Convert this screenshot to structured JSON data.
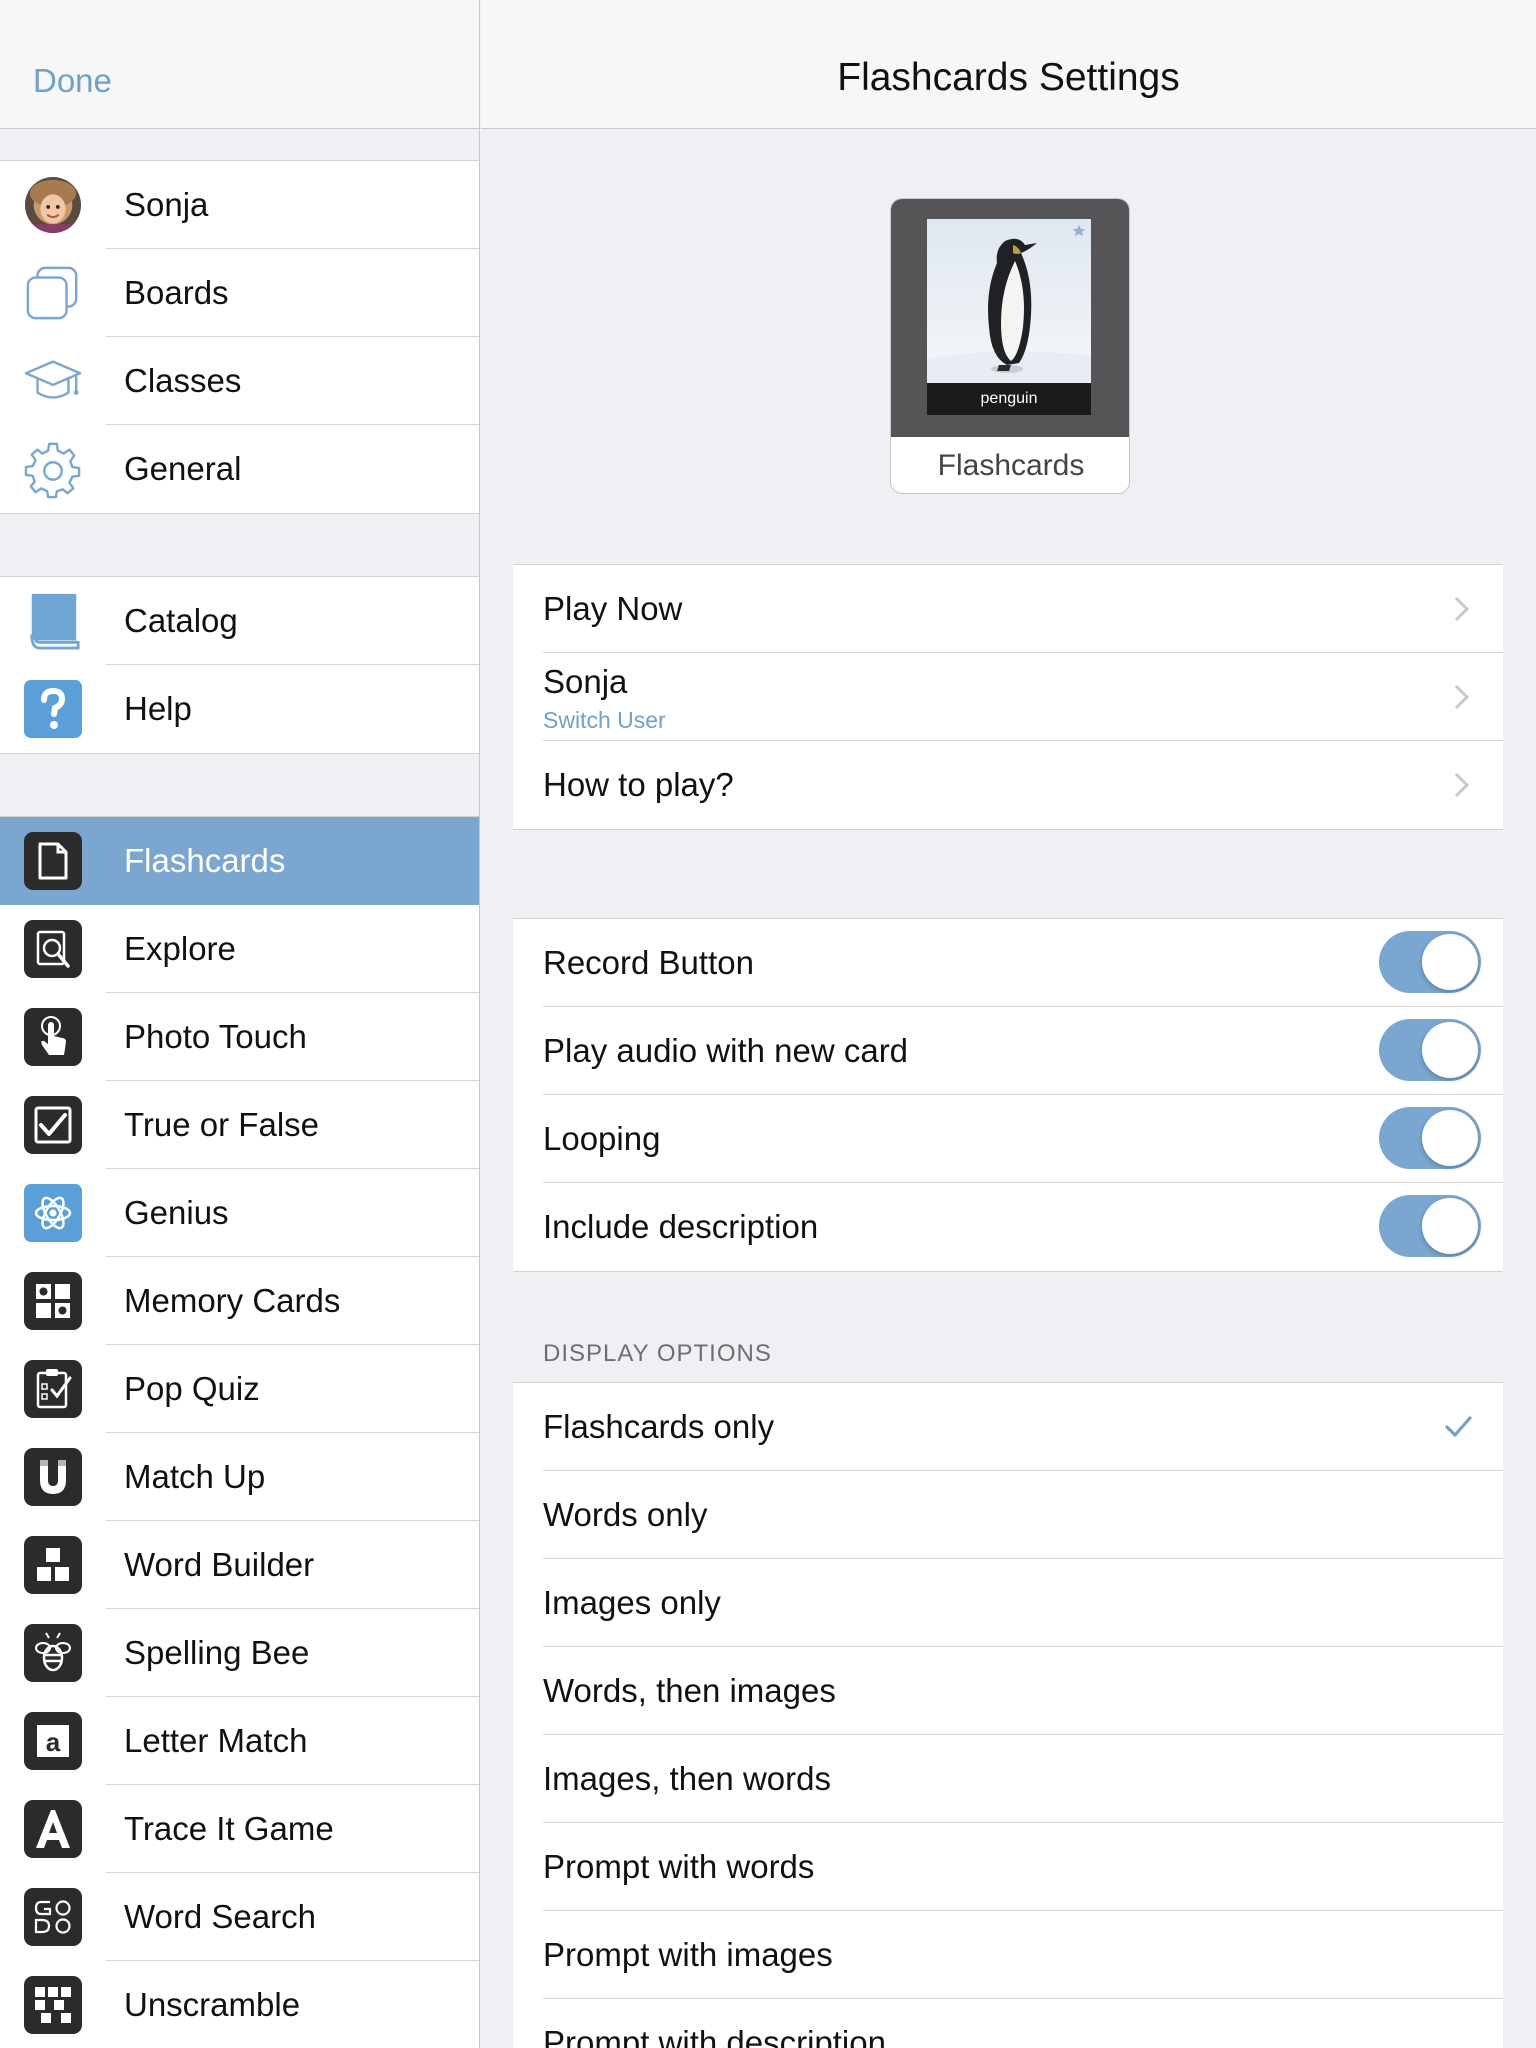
{
  "sidebar": {
    "done_label": "Done",
    "group1": [
      {
        "label": "Sonja",
        "icon": "user-avatar"
      },
      {
        "label": "Boards",
        "icon": "boards-icon"
      },
      {
        "label": "Classes",
        "icon": "graduation-cap-icon"
      },
      {
        "label": "General",
        "icon": "gear-icon"
      }
    ],
    "group2": [
      {
        "label": "Catalog",
        "icon": "book-icon"
      },
      {
        "label": "Help",
        "icon": "question-icon"
      }
    ],
    "games": [
      {
        "label": "Flashcards",
        "icon": "flashcard-icon",
        "active": true
      },
      {
        "label": "Explore",
        "icon": "magnifier-icon"
      },
      {
        "label": "Photo Touch",
        "icon": "touch-hand-icon"
      },
      {
        "label": "True or False",
        "icon": "checkbox-icon"
      },
      {
        "label": "Genius",
        "icon": "atom-icon"
      },
      {
        "label": "Memory Cards",
        "icon": "memory-grid-icon"
      },
      {
        "label": "Pop Quiz",
        "icon": "clipboard-icon"
      },
      {
        "label": "Match Up",
        "icon": "magnet-icon"
      },
      {
        "label": "Word Builder",
        "icon": "blocks-icon"
      },
      {
        "label": "Spelling Bee",
        "icon": "bee-icon"
      },
      {
        "label": "Letter Match",
        "icon": "letter-a-tile-icon"
      },
      {
        "label": "Trace It Game",
        "icon": "letter-a-icon"
      },
      {
        "label": "Word Search",
        "icon": "word-search-icon"
      },
      {
        "label": "Unscramble",
        "icon": "unscramble-icon"
      }
    ]
  },
  "main": {
    "title": "Flashcards Settings",
    "tile": {
      "caption": "penguin",
      "label": "Flashcards"
    },
    "nav_group": {
      "play_now": "Play Now",
      "user_name": "Sonja",
      "user_sub": "Switch User",
      "how_to_play": "How to play?"
    },
    "toggles": [
      {
        "label": "Record Button",
        "on": true
      },
      {
        "label": "Play audio with new card",
        "on": true
      },
      {
        "label": "Looping",
        "on": true
      },
      {
        "label": "Include description",
        "on": true
      }
    ],
    "display_options": {
      "header": "DISPLAY OPTIONS",
      "options": [
        {
          "label": "Flashcards only",
          "selected": true
        },
        {
          "label": "Words only"
        },
        {
          "label": "Images only"
        },
        {
          "label": "Words, then images"
        },
        {
          "label": "Images, then words"
        },
        {
          "label": "Prompt with words"
        },
        {
          "label": "Prompt with images"
        },
        {
          "label": "Prompt with description"
        }
      ]
    }
  },
  "colors": {
    "accent": "#7aa6cf",
    "link": "#6fa1c9",
    "dark_tile": "#2b2b2b",
    "blue_tile": "#5b9fd8"
  }
}
